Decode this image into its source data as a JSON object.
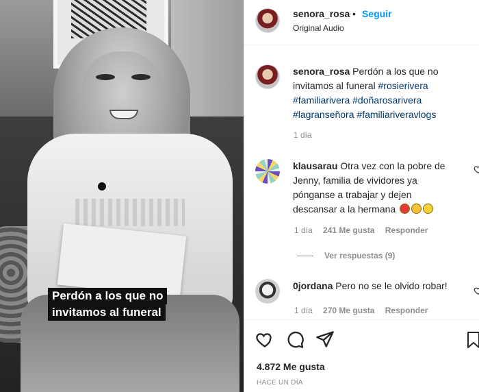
{
  "media": {
    "overlay_caption_lines": [
      "Perdón a los que no",
      "invitamos al funeral"
    ]
  },
  "header": {
    "username": "senora_rosa",
    "separator": "•",
    "follow_label": "Seguir",
    "audio_label": "Original Audio"
  },
  "caption": {
    "username": "senora_rosa",
    "text": "Perdón a los que no invitamos al funeral",
    "hashtags": [
      "#rosierivera",
      "#familiarivera",
      "#doñarosarivera",
      "#lagranseñora",
      "#familiariveravlogs"
    ],
    "time": "1 día"
  },
  "comments": [
    {
      "username": "klausarau",
      "text": "Otra vez con la pobre de Jenny, familia de vividores ya pónganse a trabajar y dejen descansar a la hermana",
      "emojis": [
        "angry-face",
        "unamused-face",
        "eye-roll-face"
      ],
      "time": "1 día",
      "likes": "241 Me gusta",
      "reply_label": "Responder",
      "view_replies": "Ver respuestas (9)"
    },
    {
      "username": "0jordana",
      "text": "Pero no se le olvido robar!",
      "time": "1 día",
      "likes": "270 Me gusta",
      "reply_label": "Responder"
    }
  ],
  "footer": {
    "likes": "4.872 Me gusta",
    "time_ago": "HACE UN DÍA"
  },
  "colors": {
    "follow_blue": "#0095f6",
    "hashtag": "#00376b",
    "secondary_text": "#8e8e8e"
  }
}
